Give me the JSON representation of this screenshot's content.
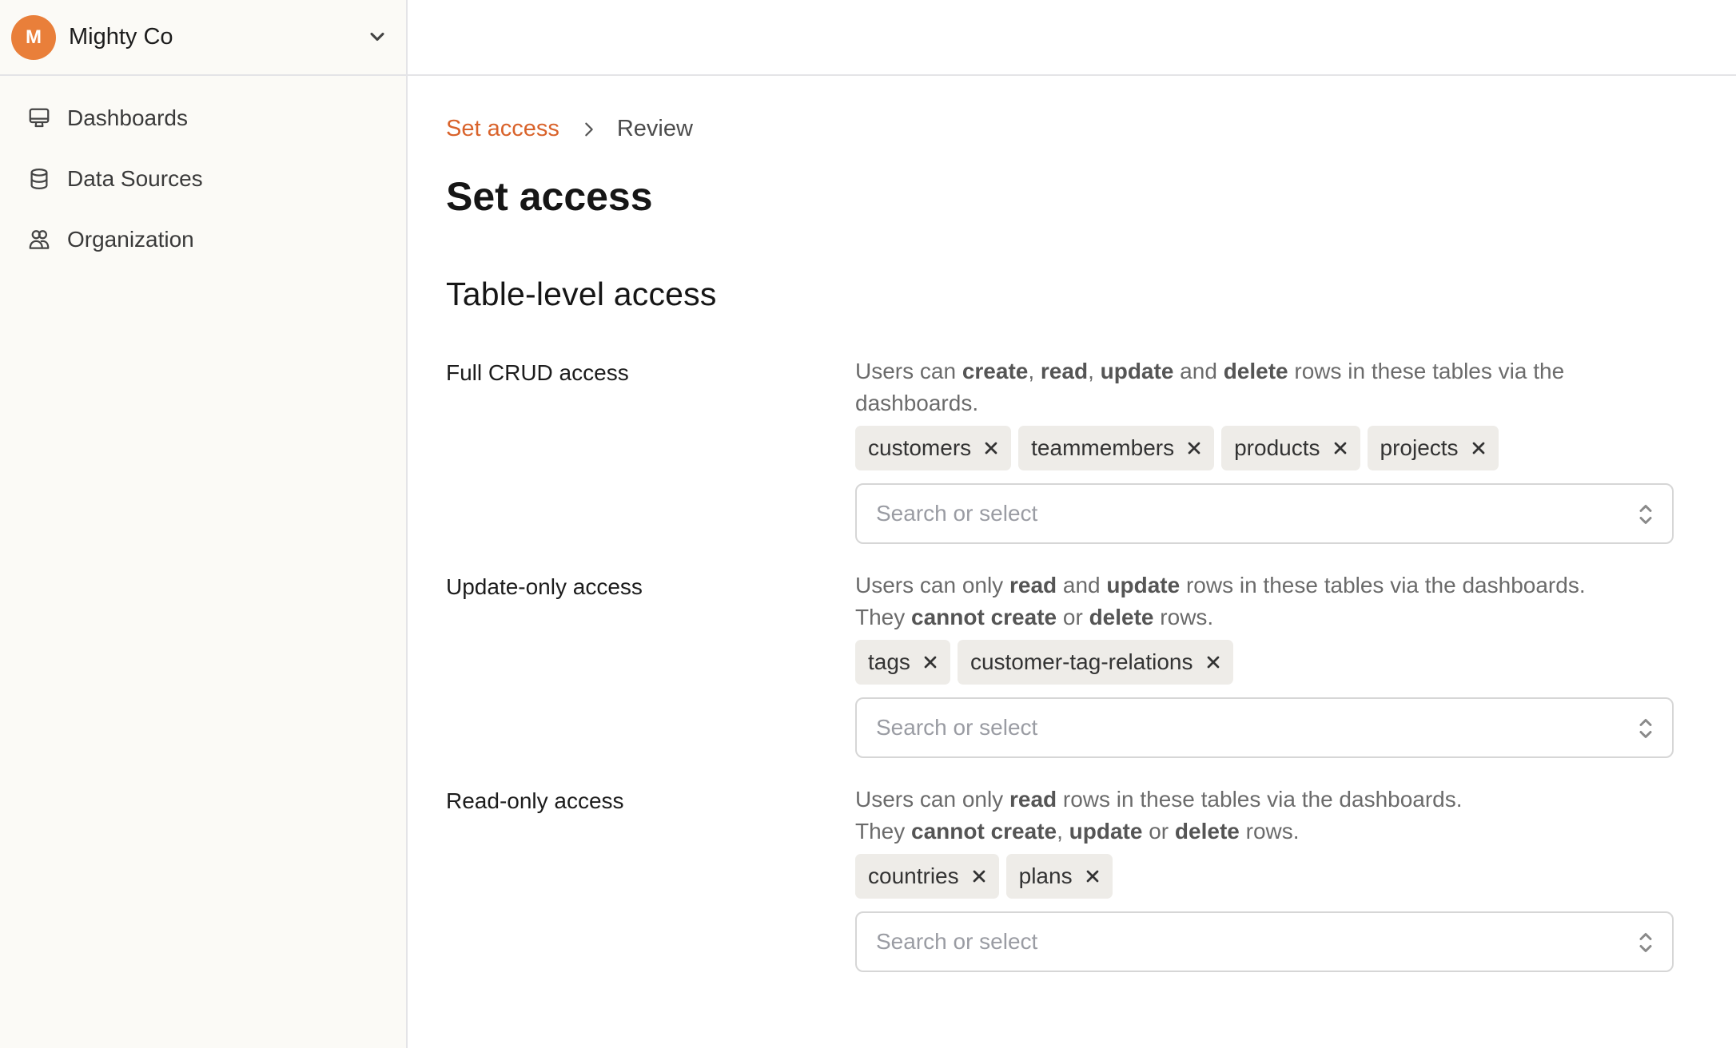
{
  "org": {
    "avatar_letter": "M",
    "name": "Mighty Co",
    "avatar_color": "#e97f3a"
  },
  "sidebar": {
    "items": [
      {
        "label": "Dashboards",
        "icon": "monitor-icon"
      },
      {
        "label": "Data Sources",
        "icon": "database-icon"
      },
      {
        "label": "Organization",
        "icon": "users-icon"
      }
    ]
  },
  "breadcrumb": {
    "items": [
      "Set access",
      "Review"
    ],
    "active_color": "#d9632b"
  },
  "page": {
    "title": "Set access",
    "section_title": "Table-level access"
  },
  "access_levels": [
    {
      "label": "Full CRUD access",
      "description_parts": [
        {
          "t": "Users can "
        },
        {
          "t": "create",
          "b": true
        },
        {
          "t": ", "
        },
        {
          "t": "read",
          "b": true
        },
        {
          "t": ", "
        },
        {
          "t": "update",
          "b": true
        },
        {
          "t": " and "
        },
        {
          "t": "delete",
          "b": true
        },
        {
          "t": " rows in these tables via the dashboards."
        }
      ],
      "tags": [
        "customers",
        "teammembers",
        "products",
        "projects"
      ],
      "select_placeholder": "Search or select",
      "select_value": ""
    },
    {
      "label": "Update-only access",
      "description_parts": [
        {
          "t": "Users can only "
        },
        {
          "t": "read",
          "b": true
        },
        {
          "t": " and "
        },
        {
          "t": "update",
          "b": true
        },
        {
          "t": " rows in these tables via the dashboards."
        },
        {
          "br": true
        },
        {
          "t": "They "
        },
        {
          "t": "cannot create",
          "b": true
        },
        {
          "t": " or "
        },
        {
          "t": "delete",
          "b": true
        },
        {
          "t": " rows."
        }
      ],
      "tags": [
        "tags",
        "customer-tag-relations"
      ],
      "select_placeholder": "Search or select",
      "select_value": ""
    },
    {
      "label": "Read-only access",
      "description_parts": [
        {
          "t": "Users can only "
        },
        {
          "t": "read",
          "b": true
        },
        {
          "t": " rows in these tables via the dashboards."
        },
        {
          "br": true
        },
        {
          "t": "They "
        },
        {
          "t": "cannot create",
          "b": true
        },
        {
          "t": ", "
        },
        {
          "t": "update",
          "b": true
        },
        {
          "t": " or "
        },
        {
          "t": "delete",
          "b": true
        },
        {
          "t": " rows."
        }
      ],
      "tags": [
        "countries",
        "plans"
      ],
      "select_placeholder": "Search or select",
      "select_value": ""
    }
  ]
}
